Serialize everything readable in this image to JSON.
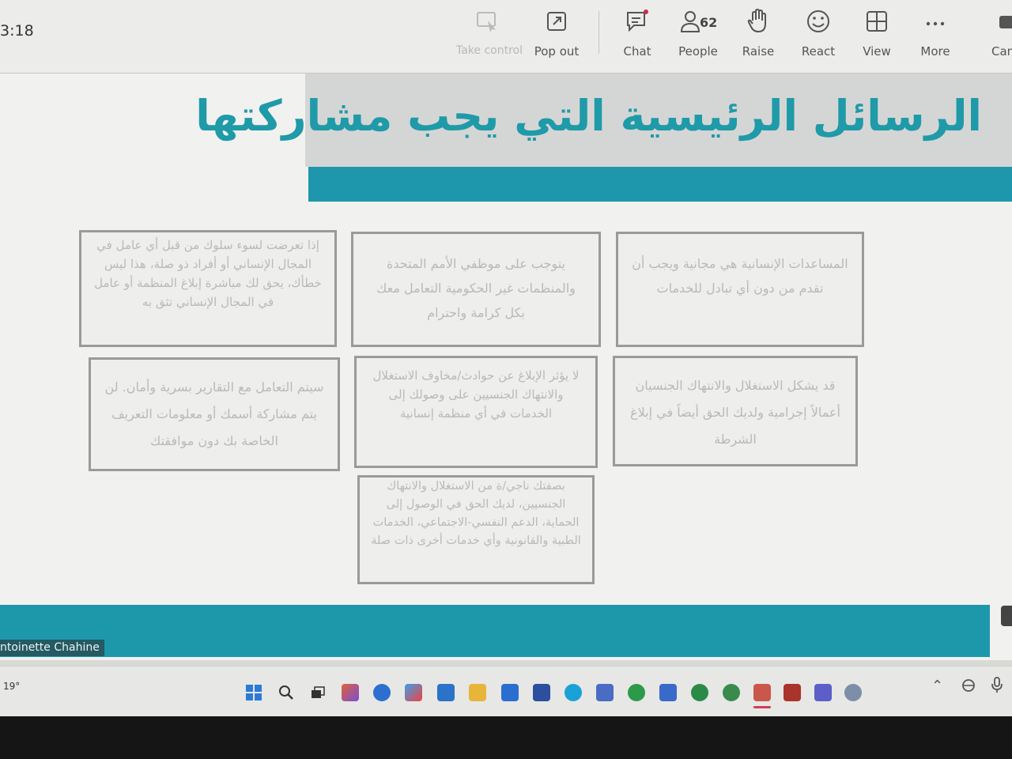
{
  "clock": "3:18",
  "toolbar": {
    "take_control": "Take control",
    "pop_out": "Pop out",
    "chat": "Chat",
    "people": "People",
    "people_count": "62",
    "raise": "Raise",
    "react": "React",
    "view": "View",
    "more": "More",
    "camera": "Cam"
  },
  "slide": {
    "title": "الرسائل الرئيسية التي يجب مشاركتها",
    "boxes": [
      "المساعدات الإنسانية هي مجانية ويجب أن تقدم من دون أي تبادل للخدمات",
      "يتوجب على موظفي الأمم المتحدة والمنظمات غير الحكومية التعامل معك بكل كرامة واحترام",
      "إذا تعرضت لسوء سلوك من قبل أي عامل في المجال الإنساني أو أفراد ذو صلة، هذا ليس خطأك، يحق لك مباشرة إبلاغ المنظمة أو عامل في المجال الإنساني تثق به",
      "قد يشكل الاستغلال والانتهاك الجنسيان أعمالاً إجرامية ولديك الحق أيضاً في إبلاغ الشرطة",
      "لا يؤثر الإبلاغ عن حوادث/مخاوف الاستغلال والانتهاك الجنسيين على وصولك إلى الخدمات في أي منظمة إنسانية",
      "سيتم التعامل مع التقارير بسرية وأمان. لن يتم مشاركة أسمك أو معلومات التعريف الخاصة بك دون موافقتك",
      "بصفتك ناجي/ة من الاستغلال والانتهاك الجنسيين، لديك الحق في الوصول إلى الحماية، الدعم النفسي-الاجتماعي، الخدمات الطبية والقانونية وأي خدمات أخرى ذات صلة"
    ]
  },
  "presenter": "ntoinette Chahine",
  "taskbar": {
    "weather": "19°"
  },
  "colors": {
    "accent": "#1e97ad",
    "title_text": "#1f9aa8",
    "box_border": "#9a9a98"
  },
  "icons": [
    "take-control-icon",
    "pop-out-icon",
    "chat-icon",
    "people-icon",
    "raise-hand-icon",
    "react-icon",
    "view-icon",
    "more-icon",
    "camera-icon",
    "windows-start-icon",
    "search-icon"
  ]
}
